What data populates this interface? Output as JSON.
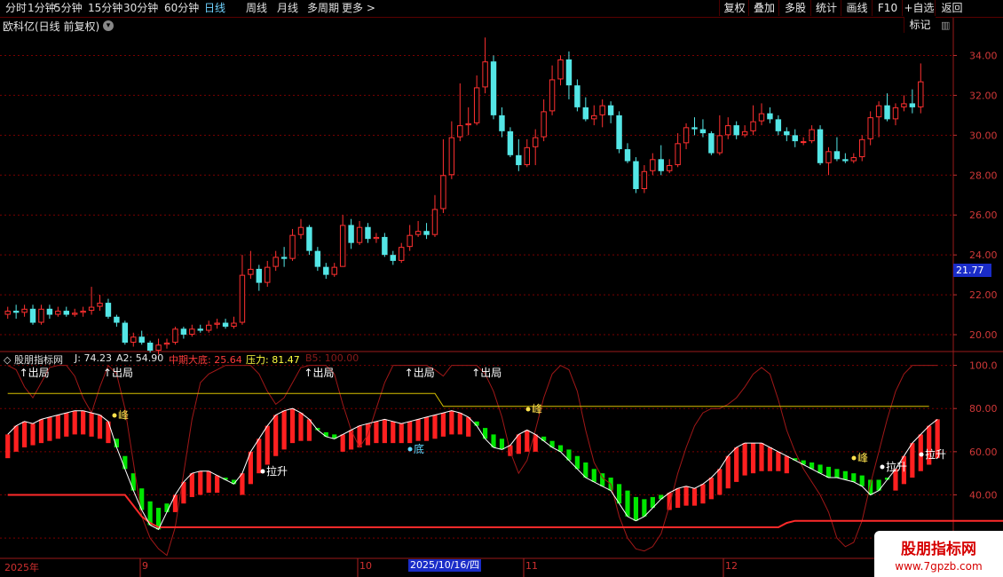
{
  "toolbar": {
    "periods": [
      "分时",
      "1分钟",
      "5分钟",
      "15分钟",
      "30分钟",
      "60分钟",
      "日线",
      "周线",
      "月线",
      "多周期",
      "更多 >"
    ],
    "active_period": "日线",
    "buttons": [
      "复权",
      "叠加",
      "多股",
      "统计",
      "画线",
      "F10",
      "+自选",
      "返回"
    ],
    "corner_labels": [
      "标记"
    ]
  },
  "symbol_title": "欧科亿(日线 前复权)",
  "price_axis": {
    "ticks": [
      "34.00",
      "32.00",
      "30.00",
      "28.00",
      "26.00",
      "24.00",
      "22.00",
      "20.00"
    ],
    "current": "21.77"
  },
  "indicator": {
    "name": "股朋指标网",
    "values": [
      {
        "label": "J: 74.23",
        "color": "#e8e8e8"
      },
      {
        "label": "A2: 54.90",
        "color": "#e8e8e8"
      },
      {
        "label": "中期大底: 25.64",
        "color": "#ff3b3b"
      },
      {
        "label": "压力: 81.47",
        "color": "#ffff40"
      },
      {
        "label": "B5: 100.00",
        "color": "#8b1a1a"
      }
    ],
    "axis_ticks": [
      "100.0",
      "80.00",
      "60.00",
      "40.00",
      "20.00"
    ],
    "annotations": {
      "exit": "出局",
      "exit_arrow": "↑",
      "peak": "峰",
      "bottom": "底",
      "pull_up": "拉升"
    }
  },
  "x_axis": {
    "labels": [
      "2025年",
      "9",
      "10",
      "11",
      "12"
    ],
    "cursor_date": "2025/10/16/四"
  },
  "watermark": {
    "title": "股朋指标网",
    "url": "www.7gpzb.com"
  },
  "colors": {
    "up": "#ff3030",
    "down": "#54e6e6",
    "grid": "#7a0000",
    "bull": "#ff2020",
    "bear": "#00e600"
  },
  "chart_data": {
    "type": "candlestick",
    "ylim": [
      19.2,
      35.0
    ],
    "candles": [
      [
        21.0,
        21.2,
        21.4,
        20.8
      ],
      [
        21.2,
        21.1,
        21.5,
        20.8
      ],
      [
        21.1,
        21.3,
        21.5,
        20.9
      ],
      [
        21.3,
        20.6,
        21.5,
        20.5
      ],
      [
        20.6,
        21.3,
        21.5,
        20.5
      ],
      [
        21.3,
        21.0,
        21.5,
        20.8
      ],
      [
        21.0,
        21.2,
        21.4,
        20.9
      ],
      [
        21.2,
        21.0,
        21.4,
        20.9
      ],
      [
        21.0,
        21.1,
        21.3,
        20.9
      ],
      [
        21.1,
        21.2,
        21.4,
        20.9
      ],
      [
        21.2,
        21.4,
        22.4,
        21.0
      ],
      [
        21.4,
        21.6,
        22.0,
        21.2
      ],
      [
        21.6,
        20.9,
        21.8,
        20.8
      ],
      [
        20.9,
        20.6,
        21.0,
        20.4
      ],
      [
        20.6,
        19.6,
        20.7,
        19.5
      ],
      [
        19.6,
        19.9,
        20.1,
        19.4
      ],
      [
        19.9,
        19.6,
        20.2,
        19.5
      ],
      [
        19.6,
        19.2,
        19.7,
        19.1
      ],
      [
        19.2,
        19.5,
        19.8,
        19.0
      ],
      [
        19.5,
        19.6,
        19.8,
        19.3
      ],
      [
        19.6,
        20.3,
        20.4,
        19.5
      ],
      [
        20.3,
        20.0,
        20.4,
        19.8
      ],
      [
        20.0,
        20.3,
        20.5,
        19.9
      ],
      [
        20.3,
        20.2,
        20.5,
        20.1
      ],
      [
        20.2,
        20.5,
        20.7,
        20.1
      ],
      [
        20.5,
        20.6,
        20.8,
        20.3
      ],
      [
        20.6,
        20.4,
        20.8,
        20.3
      ],
      [
        20.4,
        20.6,
        20.9,
        20.3
      ],
      [
        20.6,
        23.0,
        24.0,
        20.5
      ],
      [
        23.0,
        23.3,
        24.2,
        22.8
      ],
      [
        23.3,
        22.6,
        23.5,
        22.2
      ],
      [
        22.6,
        23.4,
        23.7,
        22.4
      ],
      [
        23.4,
        23.9,
        24.2,
        23.2
      ],
      [
        23.9,
        23.8,
        24.4,
        23.4
      ],
      [
        23.8,
        25.0,
        25.3,
        23.7
      ],
      [
        25.0,
        25.4,
        25.8,
        24.8
      ],
      [
        25.4,
        24.2,
        25.5,
        24.0
      ],
      [
        24.2,
        23.4,
        24.4,
        23.2
      ],
      [
        23.4,
        23.0,
        23.6,
        22.8
      ],
      [
        23.0,
        23.4,
        23.6,
        22.9
      ],
      [
        23.4,
        25.5,
        26.0,
        23.4
      ],
      [
        25.5,
        24.6,
        25.8,
        24.3
      ],
      [
        24.6,
        25.4,
        25.7,
        24.5
      ],
      [
        25.4,
        24.8,
        25.6,
        24.6
      ],
      [
        24.8,
        24.9,
        25.1,
        24.6
      ],
      [
        24.9,
        24.0,
        25.1,
        23.9
      ],
      [
        24.0,
        23.7,
        24.2,
        23.5
      ],
      [
        23.7,
        24.4,
        24.6,
        23.6
      ],
      [
        24.4,
        25.0,
        25.5,
        24.2
      ],
      [
        25.0,
        25.2,
        25.7,
        24.9
      ],
      [
        25.2,
        25.0,
        25.6,
        24.8
      ],
      [
        25.0,
        26.3,
        27.0,
        24.9
      ],
      [
        26.3,
        28.0,
        29.8,
        26.1
      ],
      [
        28.0,
        29.9,
        30.7,
        27.8
      ],
      [
        29.9,
        30.5,
        32.6,
        29.7
      ],
      [
        30.5,
        30.6,
        31.4,
        30.0
      ],
      [
        30.6,
        32.4,
        33.0,
        30.5
      ],
      [
        32.4,
        33.7,
        34.9,
        32.1
      ],
      [
        33.7,
        31.0,
        34.0,
        30.8
      ],
      [
        31.0,
        30.2,
        31.4,
        29.9
      ],
      [
        30.2,
        29.0,
        30.4,
        28.9
      ],
      [
        29.0,
        28.5,
        29.8,
        28.2
      ],
      [
        28.5,
        29.4,
        29.8,
        28.4
      ],
      [
        29.4,
        29.9,
        30.3,
        28.5
      ],
      [
        29.9,
        31.2,
        31.8,
        29.7
      ],
      [
        31.2,
        32.8,
        33.5,
        31.0
      ],
      [
        32.8,
        33.8,
        34.0,
        32.5
      ],
      [
        33.8,
        32.5,
        34.2,
        31.8
      ],
      [
        32.5,
        31.4,
        32.8,
        31.2
      ],
      [
        31.4,
        30.8,
        31.9,
        30.7
      ],
      [
        30.8,
        31.0,
        31.5,
        30.5
      ],
      [
        31.0,
        31.5,
        31.8,
        30.4
      ],
      [
        31.5,
        31.0,
        31.7,
        30.6
      ],
      [
        31.0,
        29.3,
        31.2,
        29.1
      ],
      [
        29.3,
        28.7,
        29.6,
        28.6
      ],
      [
        28.7,
        27.3,
        28.9,
        27.1
      ],
      [
        27.3,
        28.2,
        28.5,
        27.1
      ],
      [
        28.2,
        28.8,
        29.1,
        28.0
      ],
      [
        28.8,
        28.2,
        29.5,
        28.0
      ],
      [
        28.2,
        28.5,
        28.8,
        28.1
      ],
      [
        28.5,
        29.6,
        30.1,
        28.4
      ],
      [
        29.6,
        30.4,
        30.6,
        29.3
      ],
      [
        30.4,
        30.3,
        30.9,
        30.0
      ],
      [
        30.3,
        30.1,
        30.8,
        29.9
      ],
      [
        30.1,
        29.1,
        30.2,
        29.0
      ],
      [
        29.1,
        30.0,
        31.0,
        29.0
      ],
      [
        30.0,
        30.5,
        30.9,
        29.8
      ],
      [
        30.5,
        30.0,
        30.7,
        29.8
      ],
      [
        30.0,
        30.2,
        30.5,
        29.9
      ],
      [
        30.2,
        30.7,
        31.5,
        30.0
      ],
      [
        30.7,
        31.1,
        31.6,
        30.5
      ],
      [
        31.1,
        30.8,
        31.4,
        30.6
      ],
      [
        30.8,
        30.2,
        31.0,
        30.0
      ],
      [
        30.2,
        30.0,
        30.4,
        29.7
      ],
      [
        30.0,
        29.7,
        30.3,
        29.4
      ],
      [
        29.7,
        29.7,
        29.9,
        29.5
      ],
      [
        29.7,
        30.3,
        30.5,
        29.6
      ],
      [
        30.3,
        28.6,
        30.5,
        28.5
      ],
      [
        28.6,
        29.2,
        29.4,
        28.0
      ],
      [
        29.2,
        28.8,
        29.9,
        28.7
      ],
      [
        28.8,
        28.7,
        29.1,
        28.6
      ],
      [
        28.7,
        28.9,
        29.1,
        28.6
      ],
      [
        28.9,
        29.8,
        30.0,
        28.7
      ],
      [
        29.8,
        30.9,
        31.2,
        29.5
      ],
      [
        30.9,
        31.5,
        31.7,
        29.9
      ],
      [
        31.5,
        30.8,
        32.1,
        30.7
      ],
      [
        30.8,
        31.4,
        31.6,
        30.5
      ],
      [
        31.4,
        31.6,
        32.0,
        31.2
      ],
      [
        31.6,
        31.4,
        32.3,
        31.1
      ],
      [
        31.4,
        32.7,
        33.6,
        31.1
      ]
    ],
    "osc_ylim": [
      11,
      106
    ],
    "band_top": [
      87,
      87,
      87,
      87,
      87,
      87,
      87,
      87,
      87,
      87,
      87,
      87,
      87,
      87,
      87,
      87,
      87,
      87,
      87,
      87,
      87,
      87,
      87,
      87,
      87,
      87,
      87,
      87,
      87,
      87,
      87,
      87,
      87,
      87,
      87,
      87,
      87,
      87,
      87,
      87,
      87,
      87,
      87,
      87,
      87,
      87,
      87,
      87,
      87,
      87,
      87,
      87,
      81,
      81,
      81,
      81,
      81,
      81,
      81,
      81,
      81,
      81,
      81,
      81,
      81,
      81,
      81,
      81,
      81,
      81,
      81,
      81,
      81,
      81,
      81,
      81,
      81,
      81,
      81,
      81,
      81,
      81,
      81,
      81,
      81,
      81,
      81,
      81,
      81,
      81,
      81,
      81,
      81,
      81,
      81,
      81,
      81,
      81,
      81,
      81,
      81,
      81,
      81,
      81,
      81,
      81,
      81,
      81,
      81,
      81,
      81
    ],
    "bottom_line": [
      40,
      40,
      40,
      40,
      40,
      40,
      40,
      40,
      40,
      40,
      40,
      40,
      40,
      40,
      40,
      35,
      30,
      27,
      25,
      25,
      25,
      25,
      25,
      25,
      25,
      25,
      25,
      25,
      25,
      25,
      25,
      25,
      25,
      25,
      25,
      25,
      25,
      25,
      25,
      25,
      25,
      25,
      25,
      25,
      25,
      25,
      25,
      25,
      25,
      25,
      25,
      25,
      25,
      25,
      25,
      25,
      25,
      25,
      25,
      25,
      25,
      25,
      25,
      25,
      25,
      25,
      25,
      25,
      25,
      25,
      25,
      25,
      25,
      25,
      25,
      25,
      25,
      25,
      25,
      25,
      25,
      25,
      25,
      25,
      25,
      25,
      25,
      25,
      25,
      25,
      25,
      25,
      25,
      27,
      28,
      28,
      28,
      28,
      28,
      28,
      28,
      28,
      28,
      28,
      28,
      28,
      28,
      28,
      28,
      28,
      28,
      28,
      28,
      28,
      28,
      28,
      28,
      28,
      28,
      28,
      28
    ],
    "osc": [
      68,
      72,
      74,
      73,
      75,
      76,
      77,
      78,
      79,
      79,
      78,
      77,
      74,
      62,
      52,
      42,
      33,
      26,
      24,
      32,
      40,
      46,
      50,
      51,
      51,
      49,
      47,
      45,
      50,
      60,
      66,
      72,
      77,
      79,
      80,
      78,
      75,
      70,
      67,
      66,
      68,
      70,
      72,
      73,
      74,
      75,
      74,
      73,
      74,
      75,
      76,
      77,
      78,
      79,
      78,
      76,
      72,
      66,
      62,
      61,
      63,
      68,
      70,
      68,
      65,
      62,
      60,
      56,
      52,
      48,
      46,
      44,
      42,
      36,
      30,
      28,
      30,
      34,
      38,
      41,
      43,
      44,
      43,
      45,
      48,
      52,
      58,
      62,
      64,
      64,
      64,
      62,
      60,
      58,
      56,
      54,
      52,
      50,
      48,
      48,
      47,
      46,
      44,
      40,
      42,
      47,
      52,
      58,
      64,
      68,
      72,
      75
    ],
    "mid": [
      65,
      68,
      70,
      71,
      72,
      73,
      74,
      75,
      76,
      76,
      75,
      74,
      72,
      66,
      58,
      50,
      43,
      37,
      34,
      36,
      40,
      44,
      47,
      48,
      49,
      49,
      48,
      47,
      48,
      53,
      58,
      62,
      66,
      69,
      72,
      73,
      73,
      71,
      69,
      68,
      68,
      69,
      70,
      71,
      72,
      72,
      72,
      72,
      72,
      73,
      73,
      74,
      75,
      76,
      76,
      75,
      74,
      71,
      68,
      66,
      66,
      67,
      68,
      68,
      67,
      65,
      63,
      61,
      58,
      55,
      52,
      50,
      48,
      45,
      42,
      39,
      38,
      39,
      40,
      41,
      42,
      43,
      43,
      44,
      46,
      48,
      51,
      54,
      57,
      58,
      59,
      59,
      59,
      58,
      57,
      56,
      55,
      54,
      53,
      52,
      51,
      50,
      49,
      47,
      47,
      48,
      50,
      53,
      56,
      59,
      62,
      65
    ],
    "b5": [
      100,
      98,
      90,
      85,
      92,
      99,
      100,
      100,
      95,
      85,
      78,
      90,
      100,
      96,
      80,
      55,
      30,
      20,
      15,
      12,
      25,
      50,
      75,
      92,
      96,
      98,
      100,
      100,
      100,
      100,
      96,
      88,
      82,
      85,
      92,
      99,
      100,
      100,
      100,
      96,
      82,
      70,
      62,
      68,
      80,
      92,
      100,
      100,
      100,
      100,
      100,
      98,
      95,
      100,
      100,
      100,
      100,
      96,
      88,
      76,
      60,
      50,
      56,
      70,
      85,
      96,
      100,
      98,
      88,
      70,
      55,
      48,
      45,
      30,
      20,
      15,
      14,
      16,
      22,
      35,
      50,
      62,
      72,
      78,
      80,
      80,
      82,
      85,
      90,
      96,
      99,
      96,
      84,
      70,
      60,
      52,
      46,
      40,
      32,
      20,
      16,
      18,
      28,
      45,
      60,
      75,
      88,
      96,
      100,
      100,
      100,
      100
    ]
  }
}
